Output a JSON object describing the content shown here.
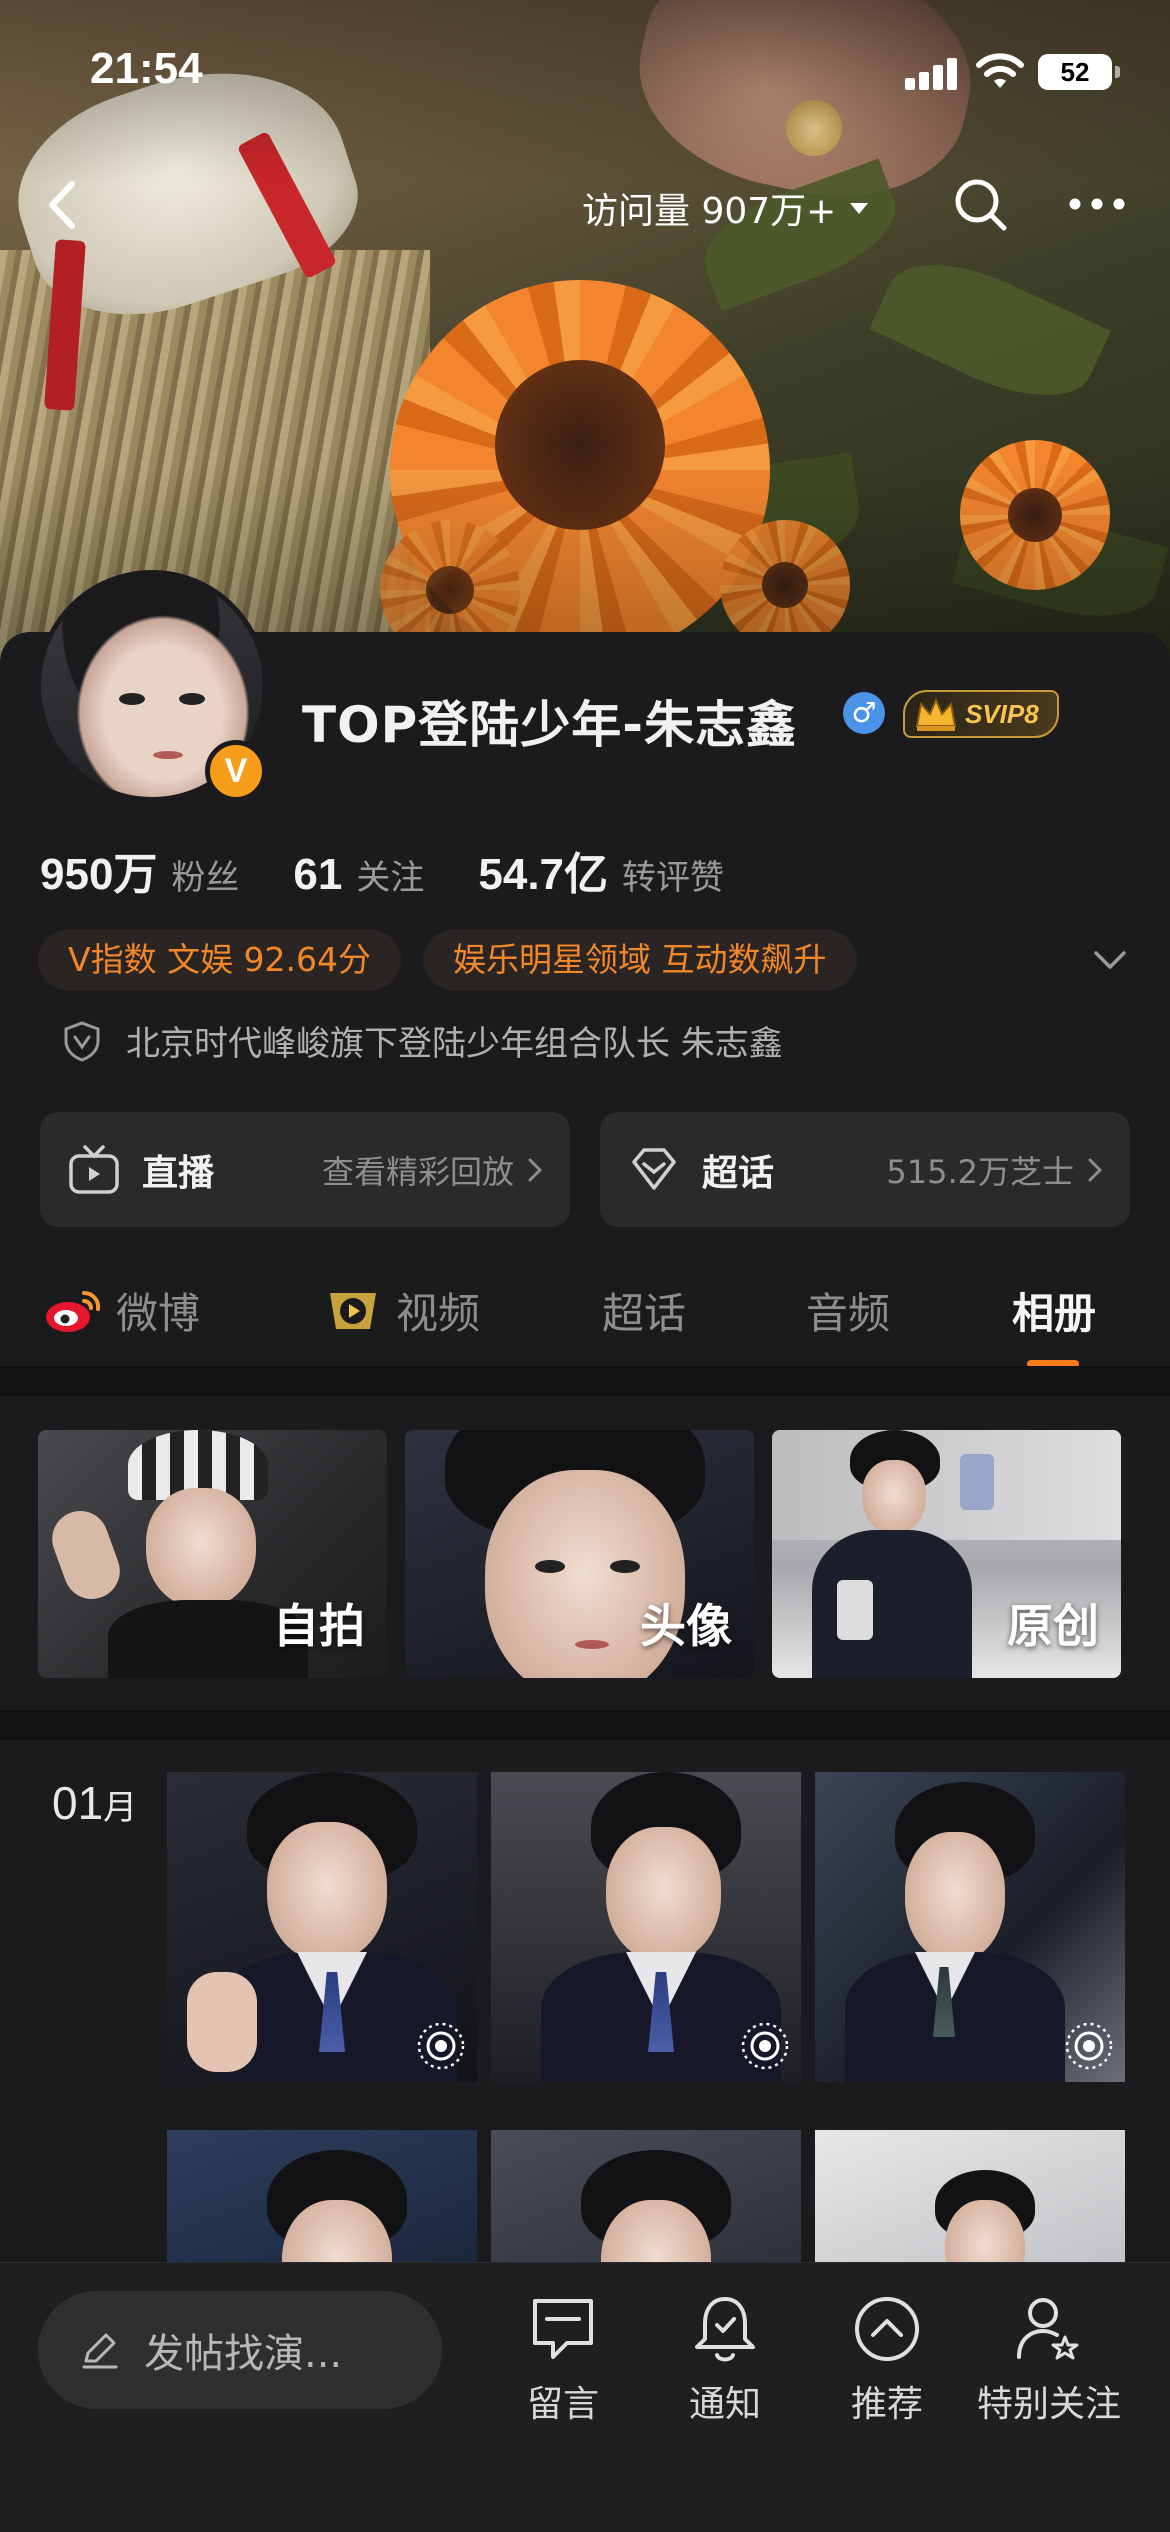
{
  "status_bar": {
    "time": "21:54",
    "battery": "52"
  },
  "top_nav": {
    "visits": "访问量 907万+"
  },
  "profile": {
    "name": "TOP登陆少年-朱志鑫",
    "gender_symbol": "♂",
    "vip_label": "SVIP8",
    "stats": [
      {
        "value": "950万",
        "label": "粉丝"
      },
      {
        "value": "61",
        "label": "关注"
      },
      {
        "value": "54.7亿",
        "label": "转评赞"
      }
    ],
    "tags": [
      "V指数 文娱 92.64分",
      "娱乐明星领域 互动数飙升"
    ],
    "bio": "北京时代峰峻旗下登陆少年组合队长 朱志鑫",
    "cards": [
      {
        "title": "直播",
        "subtitle": "查看精彩回放",
        "icon": "tv-icon"
      },
      {
        "title": "超话",
        "subtitle": "515.2万芝士",
        "icon": "diamond-icon"
      }
    ]
  },
  "tabs": [
    {
      "label": "微博",
      "icon": "weibo-logo-icon"
    },
    {
      "label": "视频",
      "icon": "video-play-icon"
    },
    {
      "label": "超话"
    },
    {
      "label": "音频"
    },
    {
      "label": "相册",
      "active": true
    }
  ],
  "albums": [
    {
      "label": "自拍"
    },
    {
      "label": "头像"
    },
    {
      "label": "原创"
    }
  ],
  "month_group": {
    "month_num": "01",
    "month_unit": "月",
    "photo_count_visible": 6,
    "live_badges": 3
  },
  "bottom_bar": {
    "compose_placeholder": "发帖找演...",
    "items": [
      {
        "label": "留言",
        "icon": "message-icon"
      },
      {
        "label": "通知",
        "icon": "bell-icon"
      },
      {
        "label": "推荐",
        "icon": "chevron-up-circle-icon"
      },
      {
        "label": "特别关注",
        "icon": "person-star-icon"
      }
    ]
  },
  "colors": {
    "accent": "#ff7a1a",
    "background": "#1b1b1d",
    "vip_gold": "#f5c452",
    "verified": "#f89c1c"
  }
}
